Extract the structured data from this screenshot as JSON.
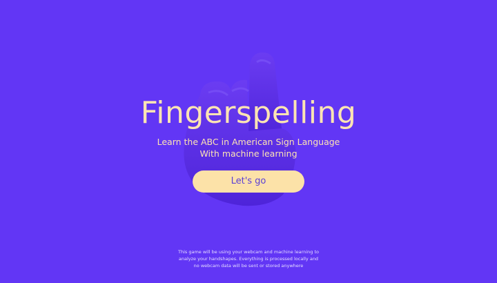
{
  "hero": {
    "title": "Fingerspelling",
    "subtitle_line1": "Learn the ABC in American Sign Language",
    "subtitle_line2": "With machine learning",
    "cta_label": "Let's go"
  },
  "disclaimer": {
    "line1": "This game will be using your webcam and machine learning to",
    "line2": "analyze your handshapes. Everything is processed locally and",
    "line3": "no webcam data will be sent or stored anywhere"
  },
  "icons": {
    "hand_illustration": "pointing-hand-illustration"
  },
  "colors": {
    "background": "#6236f5",
    "hand": "#5a2ee6",
    "title": "#fde4b3",
    "button_bg": "#fce2a8",
    "button_text": "#5a3fd6"
  }
}
